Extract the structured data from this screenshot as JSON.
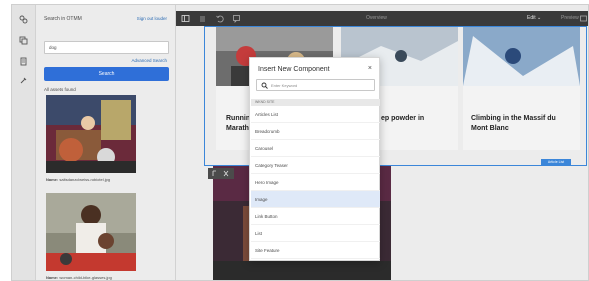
{
  "left_rail": {
    "icons": [
      "assets-icon",
      "components-icon",
      "content-tree-icon",
      "properties-icon"
    ]
  },
  "asset_panel": {
    "header": "Search in OTMM",
    "sign_in": "Sign out louder",
    "search_value": "dog",
    "advanced_search": "Advanced Search",
    "search_button": "Search",
    "results_label": "All assets found",
    "assets": [
      {
        "name_label": "Name:",
        "name": "saltsdanzclweiss-robiotel.jpg"
      },
      {
        "name_label": "Name:",
        "name": "woman-child-bike-glasses.jpg"
      }
    ]
  },
  "toolbar": {
    "title": "Overview",
    "mode": "Edit",
    "preview": "Preview"
  },
  "page": {
    "tiles": [
      {
        "title_line1": "Running",
        "title_line2": "Marath"
      },
      {
        "title_line1": "ep powder in",
        "title_line2": ""
      },
      {
        "title_line1": "Climbing in the Massif du",
        "title_line2": "Mont Blanc"
      }
    ],
    "selected_component": "Article List"
  },
  "dialog": {
    "title": "Insert New Component",
    "close": "×",
    "keyword_placeholder": "Enter Keyword",
    "group_label": "WKND SITE",
    "items": [
      {
        "label": "Articles List",
        "active": false
      },
      {
        "label": "Breadcrumb",
        "active": false
      },
      {
        "label": "Carousel",
        "active": false
      },
      {
        "label": "Category Teaser",
        "active": false
      },
      {
        "label": "Hero Image",
        "active": false
      },
      {
        "label": "Image",
        "active": true
      },
      {
        "label": "Link Button",
        "active": false
      },
      {
        "label": "List",
        "active": false
      },
      {
        "label": "Site Feature",
        "active": false
      }
    ]
  },
  "colors": {
    "accent": "#2f6fd8",
    "selection": "#3b86d9",
    "toolbar": "#3a3a3a",
    "active_row": "#dfe9f8"
  }
}
